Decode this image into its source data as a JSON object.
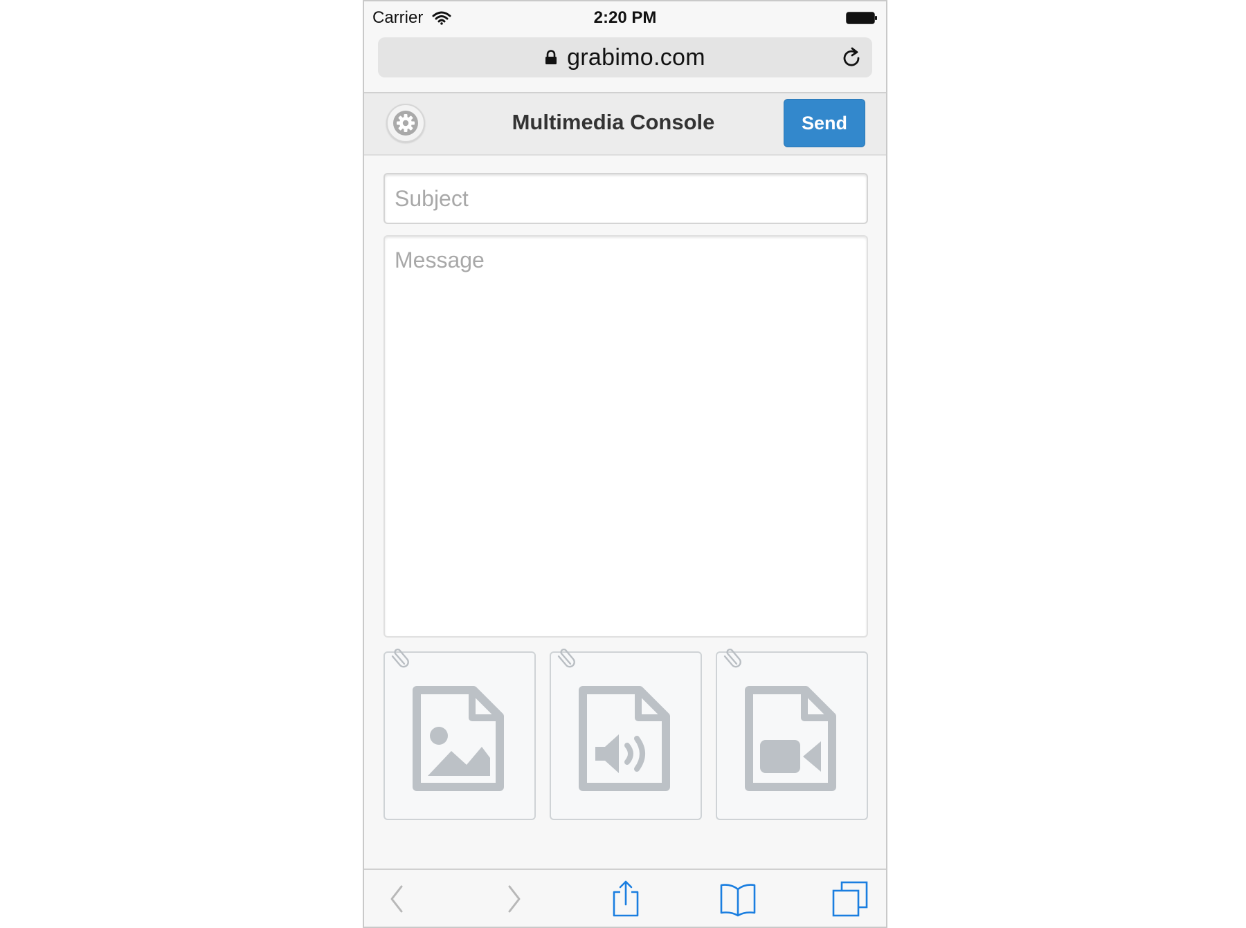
{
  "status_bar": {
    "carrier": "Carrier",
    "time": "2:20 PM",
    "icons": [
      "wifi-icon",
      "battery-icon"
    ]
  },
  "browser": {
    "url": "grabimo.com",
    "icons": [
      "lock-icon",
      "reload-icon"
    ]
  },
  "header": {
    "title": "Multimedia Console",
    "send_label": "Send",
    "settings_icon": "gear-icon",
    "accent_color": "#3388cc"
  },
  "form": {
    "subject_placeholder": "Subject",
    "subject_value": "",
    "message_placeholder": "Message",
    "message_value": ""
  },
  "attachments": [
    {
      "type": "image",
      "icon": "image-file-icon"
    },
    {
      "type": "audio",
      "icon": "audio-file-icon"
    },
    {
      "type": "video",
      "icon": "video-file-icon"
    }
  ],
  "toolbar": {
    "icons": [
      "back-icon",
      "forward-icon",
      "share-icon",
      "bookmarks-icon",
      "tabs-icon"
    ],
    "icon_color": "#1a7ee0",
    "disabled_color": "#b8b8b8"
  }
}
